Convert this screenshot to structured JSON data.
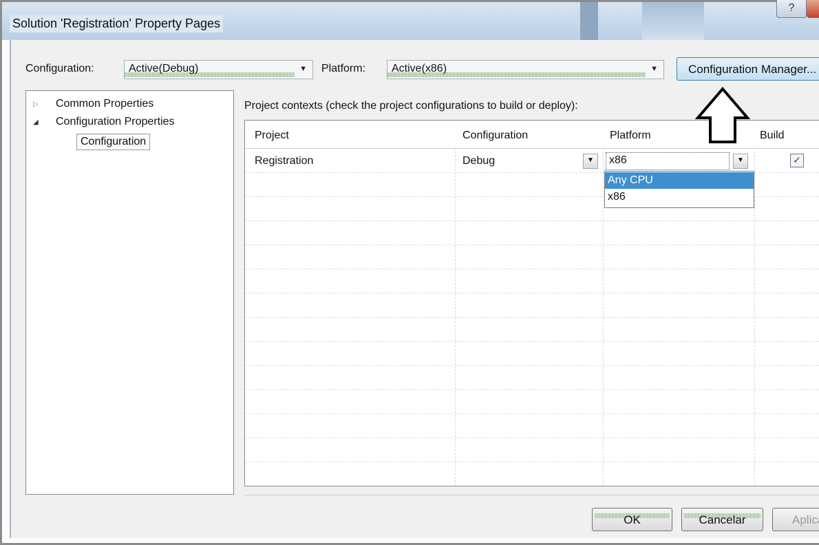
{
  "window": {
    "title": "Solution 'Registration' Property Pages",
    "help_glyph": "?"
  },
  "toolbar": {
    "configuration_label": "Configuration:",
    "configuration_value": "Active(Debug)",
    "platform_label": "Platform:",
    "platform_value": "Active(x86)",
    "config_manager_label": "Configuration Manager..."
  },
  "tree": {
    "items": [
      {
        "label": "Common Properties",
        "expander": "▷"
      },
      {
        "label": "Configuration Properties",
        "expander": "◢"
      },
      {
        "label": "Configuration"
      }
    ]
  },
  "main": {
    "heading": "Project contexts (check the project configurations to build or deploy):",
    "columns": [
      "Project",
      "Configuration",
      "Platform",
      "Build"
    ],
    "rows": [
      {
        "project": "Registration",
        "configuration": "Debug",
        "platform": "x86",
        "build": "✓"
      }
    ],
    "platform_dropdown_options": [
      "Any CPU",
      "x86"
    ]
  },
  "buttons": {
    "ok": "OK",
    "cancel": "Cancelar",
    "apply": "Aplicar"
  },
  "icons": {
    "arrow": "up-arrow-annotation-icon",
    "dropdown": "▼"
  }
}
